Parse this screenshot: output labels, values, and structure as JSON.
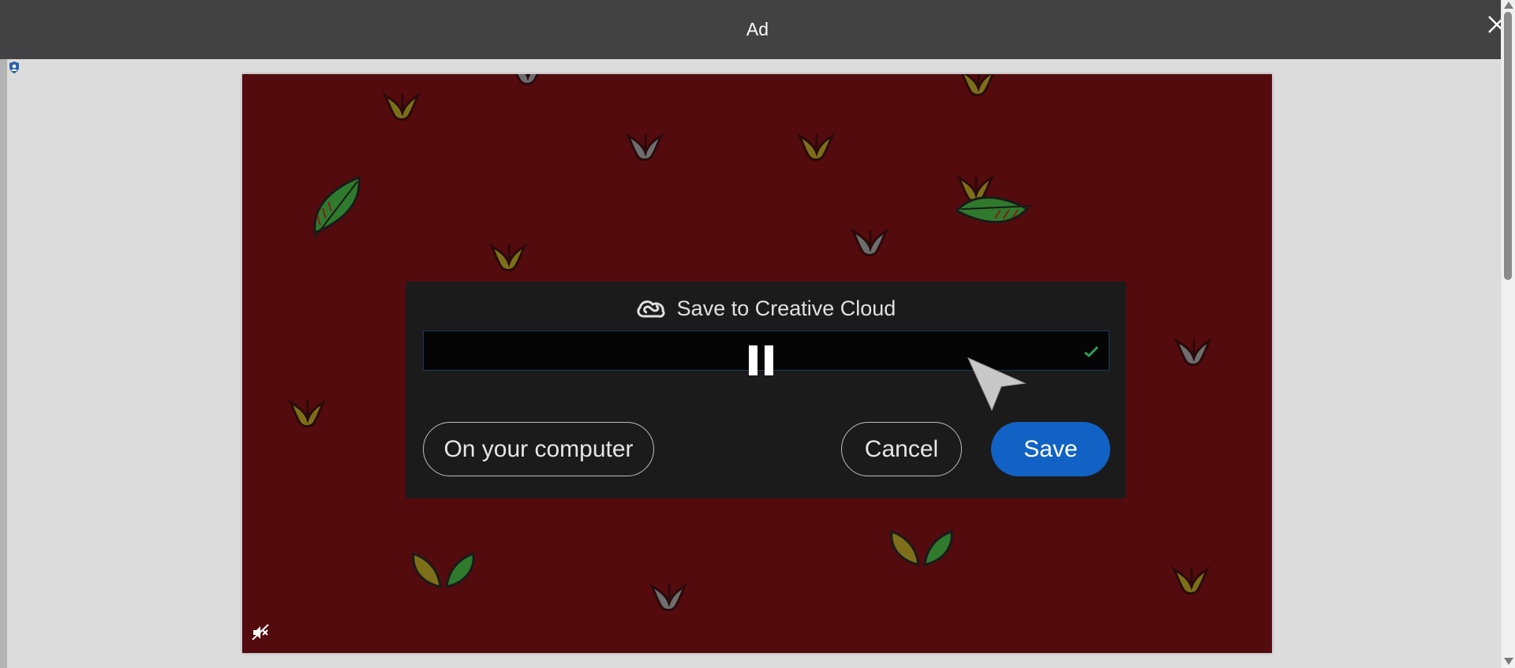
{
  "topbar": {
    "title": "Ad"
  },
  "dialog": {
    "title": "Save to Creative Cloud",
    "buttons": {
      "on_computer": "On your computer",
      "cancel": "Cancel",
      "save": "Save"
    }
  },
  "colors": {
    "topbar_bg": "#424242",
    "ad_background": "#540b0e",
    "dialog_bg": "#1b1b1b",
    "save_button": "#1162c4",
    "check": "#2f9e5a"
  },
  "icons": [
    "close-icon",
    "privacy-badge-icon",
    "creative-cloud-icon",
    "pause-icon",
    "checkmark-icon",
    "cursor-arrow-icon",
    "mute-icon",
    "scroll-up-arrow-icon",
    "scroll-down-arrow-icon"
  ]
}
